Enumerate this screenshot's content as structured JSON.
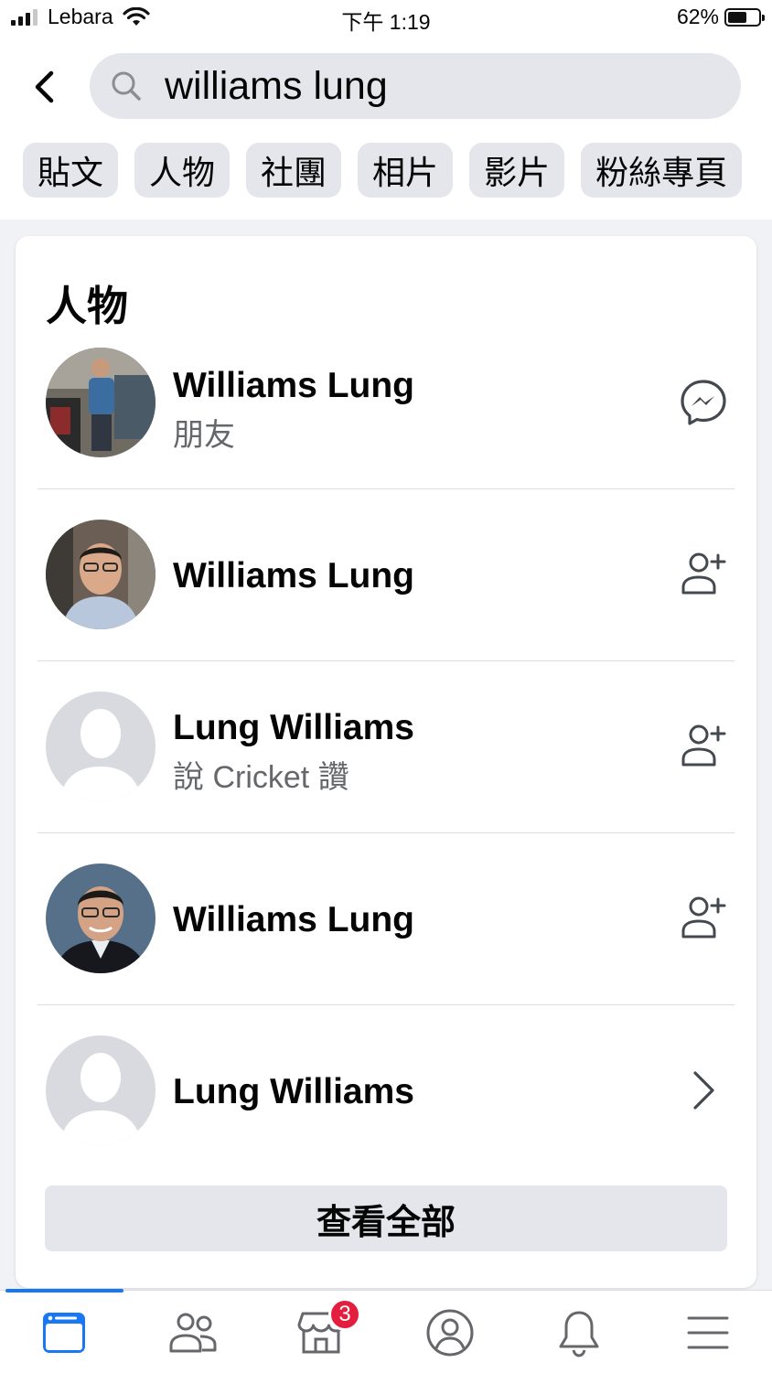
{
  "status_bar": {
    "carrier": "Lebara",
    "time": "下午 1:19",
    "battery": "62%",
    "battery_level": 0.62
  },
  "search": {
    "value": "williams lung"
  },
  "filters": [
    {
      "label": "貼文"
    },
    {
      "label": "人物"
    },
    {
      "label": "社團"
    },
    {
      "label": "相片"
    },
    {
      "label": "影片"
    },
    {
      "label": "粉絲專頁"
    }
  ],
  "people_card": {
    "title": "人物",
    "results": [
      {
        "name": "Williams Lung",
        "subtitle": "朋友",
        "action": "messenger-icon",
        "avatar": "photo-gym"
      },
      {
        "name": "Williams Lung",
        "subtitle": "",
        "action": "add-friend-icon",
        "avatar": "photo-glasses"
      },
      {
        "name": "Lung Williams",
        "subtitle": "說 Cricket 讚",
        "action": "add-friend-icon",
        "avatar": "default-silhouette"
      },
      {
        "name": "Williams Lung",
        "subtitle": "",
        "action": "add-friend-icon",
        "avatar": "photo-portrait"
      },
      {
        "name": "Lung Williams",
        "subtitle": "",
        "action": "chevron-right-icon",
        "avatar": "default-silhouette"
      }
    ],
    "see_all": "查看全部"
  },
  "tab_bar": {
    "tabs": [
      {
        "icon": "news-feed-icon",
        "active": true
      },
      {
        "icon": "friends-icon"
      },
      {
        "icon": "marketplace-icon",
        "badge": "3"
      },
      {
        "icon": "profile-icon"
      },
      {
        "icon": "notifications-icon"
      },
      {
        "icon": "menu-icon"
      }
    ]
  },
  "colors": {
    "accent": "#1877f2",
    "badge": "#e41e3f",
    "chip_bg": "#e4e6eb",
    "secondary_text": "#65676b"
  }
}
